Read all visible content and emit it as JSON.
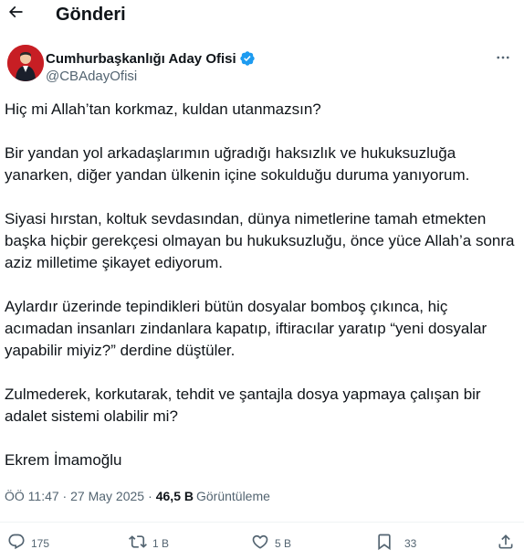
{
  "header": {
    "title": "Gönderi",
    "back_icon": "arrow-left-icon"
  },
  "author": {
    "name": "Cumhurbaşkanlığı Aday Ofisi",
    "handle": "@CBAdayOfisi",
    "verified_icon": "verified-badge-icon",
    "more_icon": "more-horizontal-icon"
  },
  "tweet": {
    "paragraphs": [
      "Hiç mi Allah’tan korkmaz, kuldan utanmazsın?",
      "Bir yandan yol arkadaşlarımın uğradığı haksızlık ve hukuksuzluğa yanarken, diğer yandan ülkenin içine sokulduğu duruma yanıyorum.",
      "Siyasi hırstan, koltuk sevdasından, dünya nimetlerine tamah etmekten başka hiçbir gerekçesi olmayan bu hukuksuzluğu, önce yüce Allah’a sonra aziz milletime şikayet ediyorum.",
      "Aylardır üzerinde tepindikleri bütün dosyalar bomboş çıkınca, hiç acımadan insanları zindanlara kapatıp, iftiracılar yaratıp “yeni dosyalar yapabilir miyiz?” derdine düştüler.",
      "Zulmederek, korkutarak, tehdit ve şantajla dosya yapmaya çalışan bir adalet sistemi olabilir mi?",
      "Ekrem İmamoğlu"
    ]
  },
  "meta": {
    "timestamp": "ÖÖ 11:47 · 27 May 2025",
    "separator": "·",
    "views_count": "46,5 B",
    "views_label": "Görüntüleme"
  },
  "actions": {
    "reply": {
      "icon": "reply-icon",
      "count": "175"
    },
    "retweet": {
      "icon": "retweet-icon",
      "count": "1 B"
    },
    "like": {
      "icon": "heart-icon",
      "count": "5 B"
    },
    "bookmark": {
      "icon": "bookmark-icon",
      "count": "33"
    },
    "share": {
      "icon": "share-icon"
    }
  },
  "colors": {
    "text_primary": "#0f1419",
    "text_secondary": "#536471",
    "verified_blue": "#1d9bf0",
    "divider": "#eff3f4",
    "avatar_red": "#c71e24"
  }
}
